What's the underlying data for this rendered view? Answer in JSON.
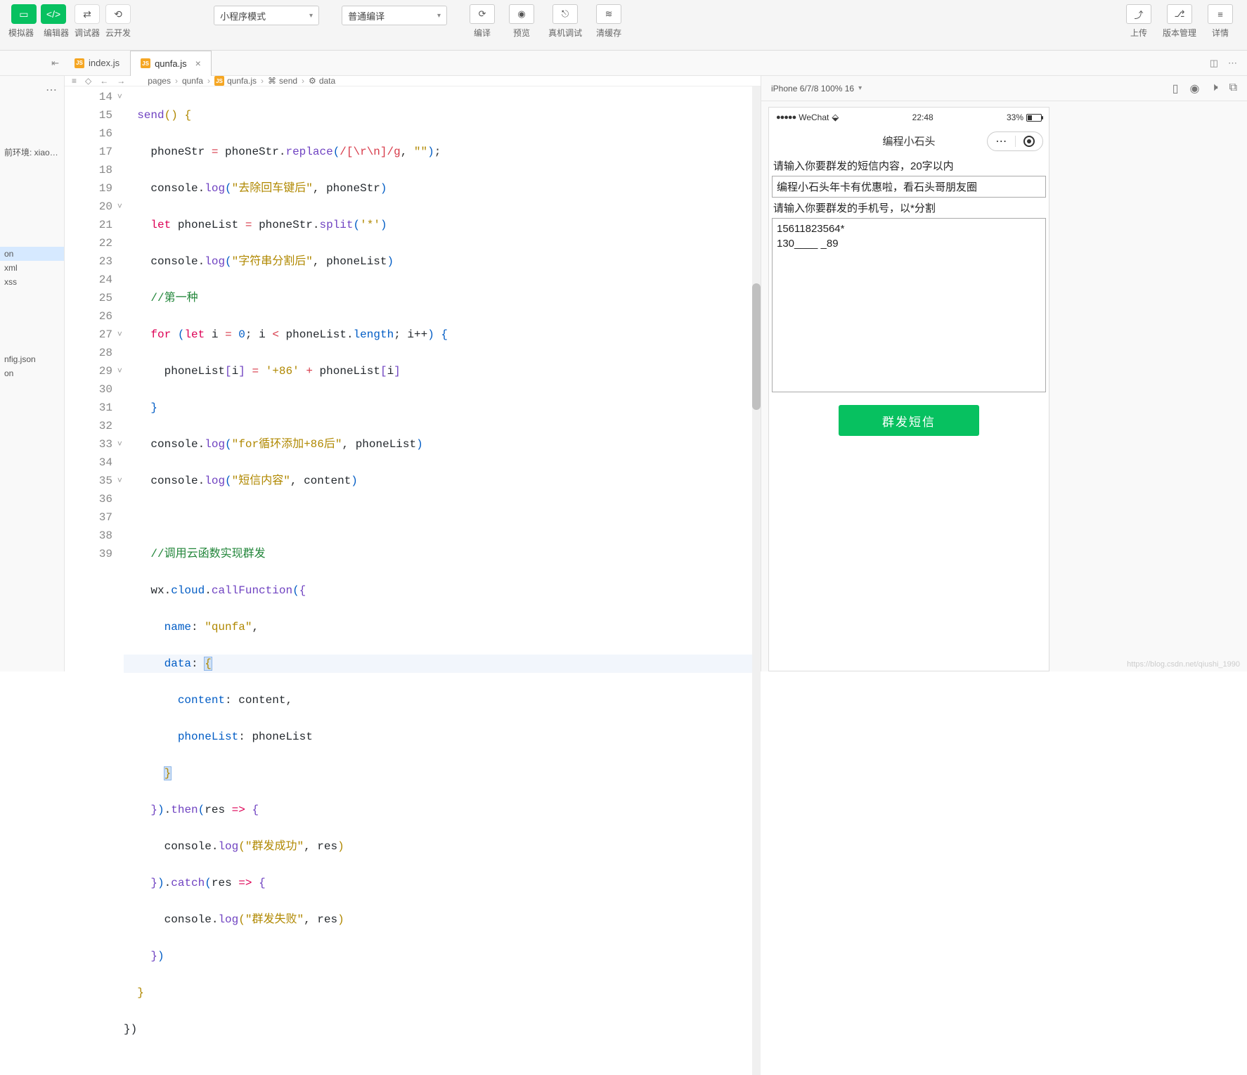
{
  "toolbar": {
    "left_labels": {
      "simulator": "模拟器",
      "editor": "编辑器",
      "debugger": "调试器",
      "cloud": "云开发"
    },
    "mode_select": "小程序模式",
    "compile_select": "普通编译",
    "mid": {
      "compile": "编译",
      "preview": "预览",
      "real": "真机调试",
      "clear": "清缓存"
    },
    "right": {
      "upload": "上传",
      "version": "版本管理",
      "detail": "详情"
    }
  },
  "tabs": {
    "inactive": "index.js",
    "active": "qunfa.js"
  },
  "crumbs": {
    "pages": "pages",
    "qunfa": "qunfa",
    "file": "qunfa.js",
    "send": "send",
    "data": "data"
  },
  "side": {
    "env_label": "前环境: xiaos...",
    "files_top": [
      "on",
      "xml",
      "xss"
    ],
    "files_bot": [
      "nfig.json",
      "on"
    ]
  },
  "code": {
    "l14": {
      "fn": "send"
    },
    "l15": {
      "id1": "phoneStr",
      "id2": "phoneStr",
      "m": "replace",
      "rgx": "/[\\r\\n]/g",
      "s": "\"\""
    },
    "l16": {
      "o": "console",
      "m": "log",
      "s": "\"去除回车键后\"",
      "id": "phoneStr"
    },
    "l17": {
      "kw": "let",
      "id1": "phoneList",
      "id2": "phoneStr",
      "m": "split",
      "s": "'*'"
    },
    "l18": {
      "o": "console",
      "m": "log",
      "s": "\"字符串分割后\"",
      "id": "phoneList"
    },
    "l19": {
      "c": "//第一种"
    },
    "l20": {
      "kw1": "for",
      "kw2": "let",
      "id": "i",
      "n": "0",
      "arr": "phoneList",
      "prop": "length",
      "inc": "i++"
    },
    "l21": {
      "arr": "phoneList",
      "idx": "i",
      "s": "'+86'",
      "arr2": "phoneList",
      "idx2": "i"
    },
    "l23": {
      "o": "console",
      "m": "log",
      "s": "\"for循环添加+86后\"",
      "id": "phoneList"
    },
    "l24": {
      "o": "console",
      "m": "log",
      "s": "\"短信内容\"",
      "id": "content"
    },
    "l26": {
      "c": "//调用云函数实现群发"
    },
    "l27": {
      "o1": "wx",
      "o2": "cloud",
      "m": "callFunction"
    },
    "l28": {
      "k": "name",
      "s": "\"qunfa\""
    },
    "l29": {
      "k": "data"
    },
    "l30": {
      "k": "content",
      "v": "content"
    },
    "l31": {
      "k": "phoneList",
      "v": "phoneList"
    },
    "l33": {
      "m": "then",
      "p": "res"
    },
    "l34": {
      "o": "console",
      "m": "log",
      "s": "\"群发成功\"",
      "id": "res"
    },
    "l35": {
      "m": "catch",
      "p": "res"
    },
    "l36": {
      "o": "console",
      "m": "log",
      "s": "\"群发失败\"",
      "id": "res"
    }
  },
  "sim": {
    "device": "iPhone 6/7/8 100% 16",
    "status": {
      "carrier": "WeChat",
      "time": "22:48",
      "batt": "33%"
    },
    "page": {
      "title": "编程小石头",
      "label1": "请输入你要群发的短信内容，20字以内",
      "input1": "编程小石头年卡有优惠啦，看石头哥朋友圈",
      "label2": "请输入你要群发的手机号，以*分割",
      "ta": "15611823564*\n130____ _89",
      "btn": "群发短信"
    }
  },
  "watermark": "https://blog.csdn.net/qiushi_1990"
}
